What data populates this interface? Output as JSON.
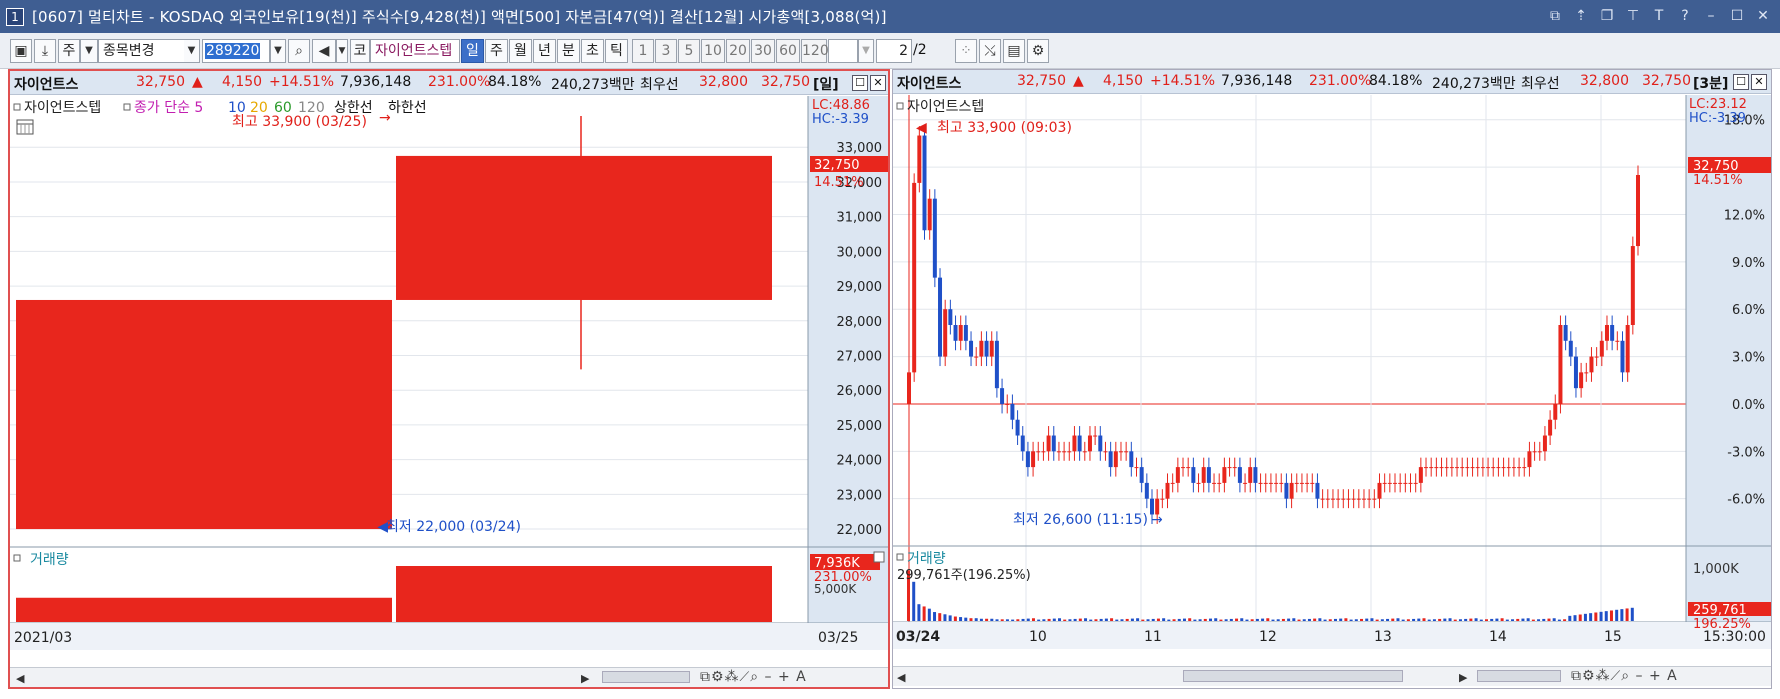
{
  "window": {
    "icon_label": "1",
    "title": "[0607] 멀티차트 - KOSDAQ 외국인보유[19(천)] 주식수[9,428(천)] 액면[500] 자본금[47(억)] 결산[12월] 시가총액[3,088(억)]"
  },
  "toolbar": {
    "market_label": "주",
    "change_stock_label": "종목변경",
    "code_value": "289220",
    "code_label": "코",
    "stock_name": "자이언트스텝",
    "period_buttons": [
      "일",
      "주",
      "월",
      "년",
      "분",
      "초",
      "틱"
    ],
    "interval_buttons": [
      "1",
      "3",
      "5",
      "10",
      "20",
      "30",
      "60",
      "120"
    ],
    "page_value": "2",
    "page_total": "/2"
  },
  "left": {
    "info": {
      "name": "자이언트스",
      "price": "32,750",
      "arrow": "▲",
      "change": "4,150",
      "change_pct": "+14.51%",
      "volume": "7,936,148",
      "vol_ratio": "231.00%",
      "rate": "84.18%",
      "amount": "240,273백만",
      "best_ask_label": "최우선",
      "best_ask": "32,800",
      "best_bid": "32,750",
      "period": "[일]"
    },
    "legend": {
      "name": "자이언트스텝",
      "ma_label": "종가 단순 5",
      "ma_10": "10",
      "ma_20": "20",
      "ma_60": "60",
      "ma_120": "120",
      "upper": "상한선",
      "lower": "하한선"
    },
    "lc": "LC:48.86",
    "hc": "HC:-3.39",
    "high_annotation": "최고 33,900 (03/25)",
    "low_annotation": "최저 22,000 (03/24)",
    "price_tag": "32,750",
    "pct_tag": "14.51%",
    "volume_label": "거래량",
    "vol_tag": "7,936K",
    "vol_pct_tag": "231.00%",
    "vol_tick": "5,000K",
    "x_start": "2021/03",
    "x_end": "03/25"
  },
  "right": {
    "info": {
      "name": "자이언트스",
      "price": "32,750",
      "arrow": "▲",
      "change": "4,150",
      "change_pct": "+14.51%",
      "volume": "7,936,148",
      "vol_ratio": "231.00%",
      "rate": "84.18%",
      "amount": "240,273백만",
      "best_ask_label": "최우선",
      "best_ask": "32,800",
      "best_bid": "32,750",
      "period": "[3분]"
    },
    "legend": {
      "name": "자이언트스텝"
    },
    "lc": "LC:23.12",
    "hc": "HC:-3.39",
    "high_annotation": "최고 33,900 (09:03)",
    "low_annotation": "최저 26,600 (11:15)",
    "price_tag": "32,750",
    "pct_tag": "14.51%",
    "volume_label": "거래량",
    "volume_annotation": "299,761주(196.25%)",
    "vol_tag": "259,761",
    "vol_pct_tag": "196.25%",
    "vol_tick": "1,000K",
    "x_labels": [
      "03/24",
      "10",
      "11",
      "12",
      "13",
      "14",
      "15"
    ],
    "time_label": "15:30:00"
  },
  "colors": {
    "up": "#e8261d",
    "down": "#1f50c8",
    "panel_bg": "#dce6f2",
    "title_bg": "#3f5e92"
  },
  "chart_data": [
    {
      "type": "candlestick",
      "title": "자이언트스텝 일봉",
      "x": [
        "03/24",
        "03/25"
      ],
      "series": [
        {
          "name": "자이언트스텝",
          "open": [
            22000,
            28600
          ],
          "high": [
            28600,
            33900
          ],
          "low": [
            22000,
            26600
          ],
          "close": [
            28600,
            32750
          ]
        }
      ],
      "yticks": [
        22000,
        23000,
        24000,
        25000,
        26000,
        27000,
        28000,
        29000,
        30000,
        31000,
        32000,
        33000
      ],
      "ylim": [
        21800,
        33900
      ],
      "volume": {
        "values": [
          3436000,
          7936148
        ],
        "ylim": [
          0,
          7936148
        ]
      },
      "legend": "top-left",
      "grid": true
    },
    {
      "type": "candlestick",
      "title": "자이언트스텝 3분봉",
      "x_ticks": [
        "03/24",
        "10",
        "11",
        "12",
        "13",
        "14",
        "15"
      ],
      "y_axis_unit": "%",
      "yticks": [
        -6.0,
        -3.0,
        0.0,
        3.0,
        6.0,
        9.0,
        12.0,
        15.0,
        18.0
      ],
      "ylim": [
        -8.3,
        18.3
      ],
      "base_price": 28600,
      "close_pct": [
        2,
        14,
        17,
        11,
        13,
        8,
        3,
        6,
        5,
        4,
        5,
        4,
        3,
        3,
        4,
        3,
        4,
        1,
        0,
        0,
        -1,
        -2,
        -3,
        -4,
        -3,
        -3,
        -3,
        -2,
        -3,
        -3,
        -3,
        -3,
        -2,
        -3,
        -3,
        -2,
        -2,
        -3,
        -3,
        -4,
        -3,
        -3,
        -3,
        -4,
        -4,
        -5,
        -6,
        -7,
        -6,
        -6,
        -5,
        -5,
        -4,
        -4,
        -4,
        -5,
        -5,
        -4,
        -5,
        -5,
        -5,
        -4,
        -4,
        -4,
        -5,
        -5,
        -4,
        -5,
        -5,
        -5,
        -5,
        -5,
        -5,
        -6,
        -5,
        -5,
        -5,
        -5,
        -5,
        -6,
        -6,
        -6,
        -6,
        -6,
        -6,
        -6,
        -6,
        -6,
        -6,
        -6,
        -6,
        -5,
        -5,
        -5,
        -5,
        -5,
        -5,
        -5,
        -5,
        -4,
        -4,
        -4,
        -4,
        -4,
        -4,
        -4,
        -4,
        -4,
        -4,
        -4,
        -4,
        -4,
        -4,
        -4,
        -4,
        -4,
        -4,
        -4,
        -4,
        -4,
        -3,
        -3,
        -3,
        -2,
        -1,
        0,
        5,
        4,
        3,
        1,
        2,
        2,
        3,
        3,
        4,
        5,
        4,
        4,
        2,
        5,
        10,
        14.5
      ],
      "volume": {
        "values_k": [
          900,
          700,
          300,
          260,
          220,
          160,
          140,
          120,
          100,
          80,
          70,
          60,
          50,
          50,
          40,
          40,
          40,
          30,
          30,
          30
        ],
        "ylim_k": [
          0,
          1000
        ]
      },
      "horizontal_lines": [
        0
      ],
      "grid": true
    }
  ]
}
